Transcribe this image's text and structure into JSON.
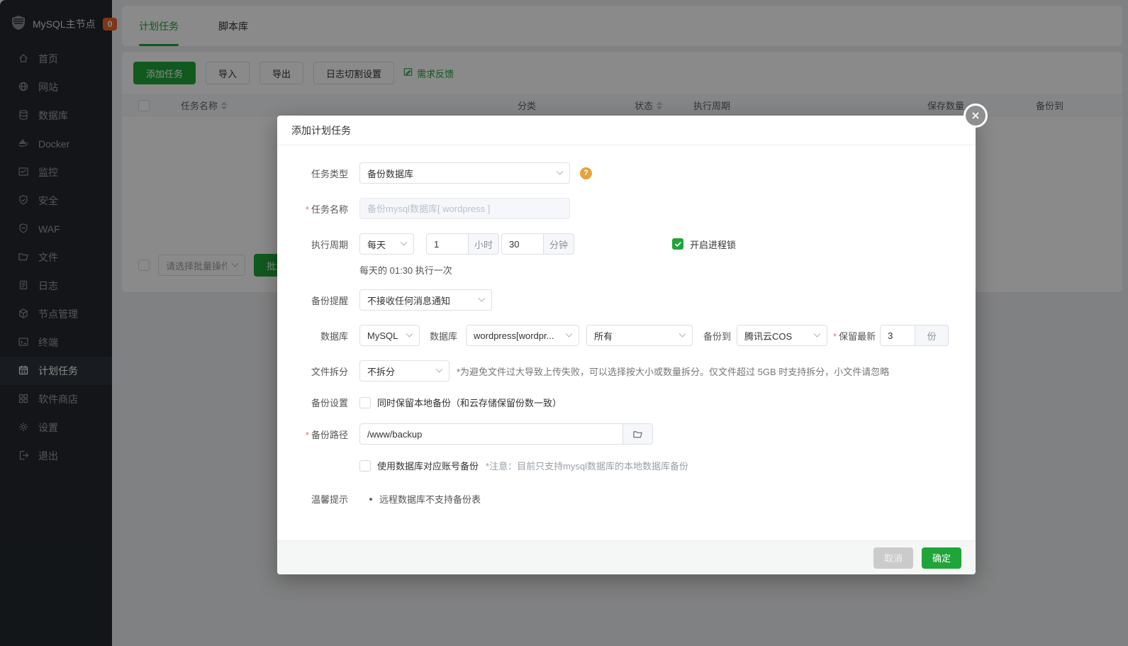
{
  "colors": {
    "accent_green": "#20a53a",
    "badge_orange": "#e9662a",
    "help_orange": "#e6a23c",
    "required_red": "#f56c6c",
    "sidebar_bg": "#23282e"
  },
  "sidebar": {
    "title": "MySQL主节点",
    "badge": "0",
    "items": [
      {
        "label": "首页"
      },
      {
        "label": "网站"
      },
      {
        "label": "数据库"
      },
      {
        "label": "Docker"
      },
      {
        "label": "监控"
      },
      {
        "label": "安全"
      },
      {
        "label": "WAF"
      },
      {
        "label": "文件"
      },
      {
        "label": "日志"
      },
      {
        "label": "节点管理"
      },
      {
        "label": "终端"
      },
      {
        "label": "计划任务"
      },
      {
        "label": "软件商店"
      },
      {
        "label": "设置"
      },
      {
        "label": "退出"
      }
    ]
  },
  "tabs": {
    "scheduled": "计划任务",
    "scripts": "脚本库"
  },
  "toolbar": {
    "add_task": "添加任务",
    "import": "导入",
    "export": "导出",
    "log_split": "日志切割设置",
    "feedback": "需求反馈"
  },
  "table": {
    "headers": {
      "task_name": "任务名称",
      "category": "分类",
      "status": "状态",
      "cycle": "执行周期",
      "keep_count": "保存数量",
      "backup_to": "备份到"
    }
  },
  "batch": {
    "select_placeholder": "请选择批量操作",
    "apply": "批量操作"
  },
  "modal": {
    "title": "添加计划任务",
    "task_type": {
      "label": "任务类型",
      "value": "备份数据库"
    },
    "task_name": {
      "label": "任务名称",
      "placeholder": "备份mysql数据库[ wordpress ]"
    },
    "cycle": {
      "label": "执行周期",
      "period": "每天",
      "hour": "1",
      "hour_unit": "小时",
      "minute": "30",
      "minute_unit": "分钟",
      "process_lock": "开启进程锁",
      "hint": "每天的 01:30 执行一次"
    },
    "notify": {
      "label": "备份提醒",
      "value": "不接收任何消息通知"
    },
    "database": {
      "label": "数据库",
      "engine": "MySQL",
      "db_label": "数据库",
      "db_value": "wordpress[wordpr...",
      "tables": "所有",
      "backup_to_label": "备份到",
      "backup_to": "腾讯云COS",
      "keep_label": "保留最新",
      "keep_value": "3",
      "keep_unit": "份"
    },
    "split": {
      "label": "文件拆分",
      "value": "不拆分",
      "note": "*为避免文件过大导致上传失败，可以选择按大小或数量拆分。仅文件超过 5GB 时支持拆分，小文件请忽略"
    },
    "backup_setting": {
      "label": "备份设置",
      "checkbox": "同时保留本地备份（和云存储保留份数一致）"
    },
    "backup_path": {
      "label": "备份路径",
      "value": "/www/backup"
    },
    "db_account": {
      "checkbox": "使用数据库对应账号备份",
      "note": "*注意：目前只支持mysql数据库的本地数据库备份"
    },
    "tips": {
      "label": "温馨提示",
      "item": "远程数据库不支持备份表"
    },
    "footer": {
      "cancel": "取消",
      "confirm": "确定"
    }
  }
}
